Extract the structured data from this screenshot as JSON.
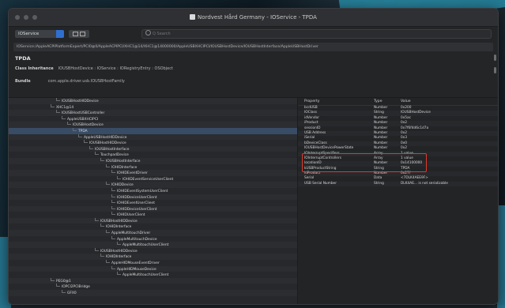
{
  "window": {
    "title": "Nordvest Hård Germany - IOService - TPDA"
  },
  "toolbar": {
    "plane": "IOService",
    "search_placeholder": "Q Search"
  },
  "path": "IOService:/AppleACPIPlatformExpert/PCI0@0/AppleACPIPCI/XHC1@14/XHC1@14000000/AppleUSBXHCIPCI/IOUSBHostDevice/IOUSBHostInterface/AppleUSBHostDriver",
  "header": {
    "name": "TPDA",
    "class_label": "Class Inheritance",
    "class_value": "IOUSBHostDevice : IOService : IORegistryEntry : OSObject",
    "bundle_label": "Bundle",
    "bundle_value": "com.apple.driver.usb.IOUSBHostFamily"
  },
  "tree": [
    {
      "indent": 6,
      "label": "IOUSBHostHIDDevice"
    },
    {
      "indent": 5,
      "label": "XHC1@14"
    },
    {
      "indent": 6,
      "label": "IOUSBHostUSBController"
    },
    {
      "indent": 7,
      "label": "AppleUSBXHCIPCI"
    },
    {
      "indent": 8,
      "label": "IOUSBHostDevice"
    },
    {
      "indent": 9,
      "label": "TPDA",
      "selected": true
    },
    {
      "indent": 10,
      "label": "AppleUSBHostHIDDevice"
    },
    {
      "indent": 11,
      "label": "IOUSBHostHIDDevice"
    },
    {
      "indent": 12,
      "label": "IOUSBHostInterface"
    },
    {
      "indent": 13,
      "label": "TouchpadDevice"
    },
    {
      "indent": 14,
      "label": "IOUSBHostInterface"
    },
    {
      "indent": 15,
      "label": "IOHIDInterface"
    },
    {
      "indent": 16,
      "label": "IOHIDEventDriver"
    },
    {
      "indent": 17,
      "label": "IOHIDEventServiceUserClient"
    },
    {
      "indent": 15,
      "label": "IOHIDDevice"
    },
    {
      "indent": 16,
      "label": "IOHIDEventSystemUserClient"
    },
    {
      "indent": 16,
      "label": "IOHIDDeviceUserClient"
    },
    {
      "indent": 16,
      "label": "IOHIDEventUserClient"
    },
    {
      "indent": 16,
      "label": "IOHIDDeviceUserClient"
    },
    {
      "indent": 16,
      "label": "IOHIDUserClient"
    },
    {
      "indent": 13,
      "label": "IOUSBHostHIDDevice"
    },
    {
      "indent": 14,
      "label": "IOHIDInterface"
    },
    {
      "indent": 15,
      "label": "AppleMultitouchDriver"
    },
    {
      "indent": 16,
      "label": "AppleMultitouchDevice"
    },
    {
      "indent": 17,
      "label": "AppleMultitouchUserClient"
    },
    {
      "indent": 13,
      "label": "IOUSBHostHIDDevice"
    },
    {
      "indent": 14,
      "label": "IOHIDInterface"
    },
    {
      "indent": 15,
      "label": "AppleHIDMouseEventDriver"
    },
    {
      "indent": 16,
      "label": "AppleHIDMouseDevice"
    },
    {
      "indent": 17,
      "label": "AppleMultitouchUserClient"
    },
    {
      "indent": 5,
      "label": "PEG0@1"
    },
    {
      "indent": 6,
      "label": "IOPCI2PCIBridge"
    },
    {
      "indent": 7,
      "label": "GFX0"
    }
  ],
  "props": {
    "columns": [
      "Property",
      "Type",
      "Value"
    ],
    "rows": [
      [
        "bcdUSB",
        "Number",
        "0x200"
      ],
      [
        "IOClass",
        "String",
        "IOUSBHostDevice"
      ],
      [
        "idVendor",
        "Number",
        "0x5ac"
      ],
      [
        "iProduct",
        "Number",
        "0x2"
      ],
      [
        "sessionID",
        "Number",
        "0x7f6f4d6c1d7a"
      ],
      [
        "USB Address",
        "Number",
        "0x2"
      ],
      [
        "iSerial",
        "Number",
        "0x3"
      ],
      [
        "bDeviceClass",
        "Number",
        "0x0"
      ],
      [
        "IOUSBHostDevicePowerState",
        "Number",
        "0x2"
      ],
      [
        "IOInterruptSpecifiers",
        "Array",
        "1 value"
      ],
      [
        "IOInterruptControllers",
        "Array",
        "1 value"
      ],
      [
        "locationID",
        "Number",
        "0x14100000"
      ],
      [
        "kUSBProductString",
        "String",
        "TPDA"
      ],
      [
        "idProduct",
        "Number",
        "0x27f"
      ],
      [
        "Serial",
        "Data",
        "<7DLK4AEE9F>"
      ],
      [
        "USB Serial Number",
        "String",
        "DLK4AE... is not serializable"
      ]
    ]
  }
}
